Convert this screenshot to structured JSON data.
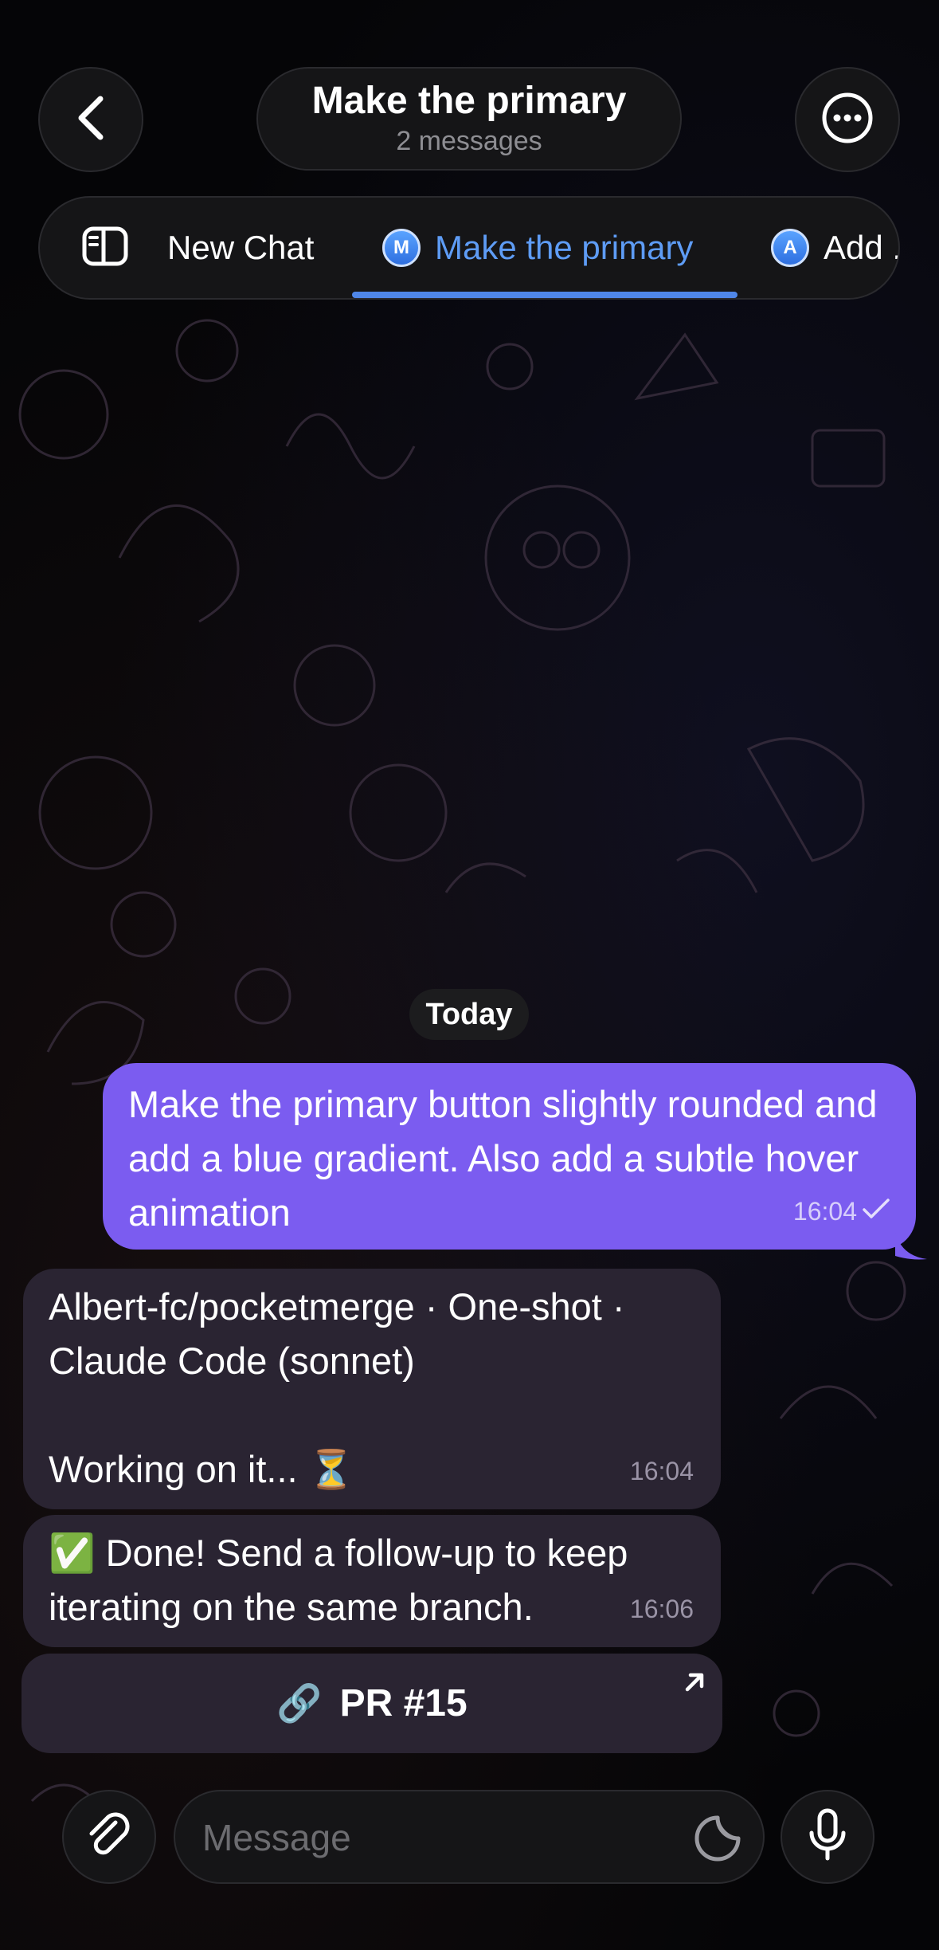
{
  "header": {
    "title": "Make the primary",
    "subtitle": "2 messages"
  },
  "tabs": [
    {
      "label": "New Chat"
    },
    {
      "label": "Make the primary",
      "avatar": "M",
      "active": true
    },
    {
      "label": "Add ...",
      "avatar": "A"
    }
  ],
  "chat": {
    "date_divider": "Today",
    "messages": [
      {
        "text": "Make the primary button slightly rounded and add a blue gradient. Also add a subtle hover animation",
        "time": "16:04",
        "outgoing": true
      },
      {
        "line1": "Albert-fc/pocketmerge · One-shot · Claude Code (sonnet)",
        "line2": "Working on it... ⏳",
        "time": "16:04"
      },
      {
        "text": "✅ Done! Send a follow-up to keep iterating on the same branch.",
        "time": "16:06"
      }
    ],
    "pr_button": {
      "icon": "🔗",
      "label": "PR #15"
    }
  },
  "composer": {
    "placeholder": "Message"
  },
  "icons": {
    "back": "chevron-left-icon",
    "more": "ellipsis-icon",
    "sidebar": "sidebar-icon",
    "attach": "paperclip-icon",
    "sticker": "sticker-icon",
    "mic": "microphone-icon",
    "external": "arrow-up-right-icon"
  },
  "colors": {
    "outgoing_bubble": "#7b5cf0",
    "incoming_bubble": "#2a2432",
    "accent": "#4f86e8"
  }
}
